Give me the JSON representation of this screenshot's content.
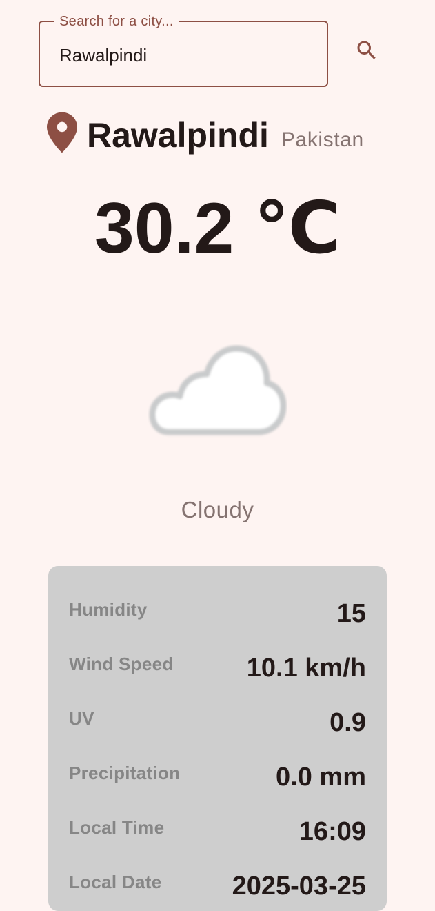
{
  "search": {
    "label": "Search for a city...",
    "value": "Rawalpindi"
  },
  "location": {
    "city": "Rawalpindi",
    "country": "Pakistan"
  },
  "weather": {
    "temperature": "30.2 ℃",
    "condition": "Cloudy",
    "icon": "cloud-icon"
  },
  "details": [
    {
      "label": "Humidity",
      "value": "15"
    },
    {
      "label": "Wind Speed",
      "value": "10.1 km/h"
    },
    {
      "label": "UV",
      "value": "0.9"
    },
    {
      "label": "Precipitation",
      "value": "0.0 mm"
    },
    {
      "label": "Local Time",
      "value": "16:09"
    },
    {
      "label": "Local Date",
      "value": "2025-03-25"
    }
  ],
  "colors": {
    "background": "#fef4f2",
    "accent": "#8d4f44",
    "card": "#cecece",
    "muted_text": "#857371"
  }
}
